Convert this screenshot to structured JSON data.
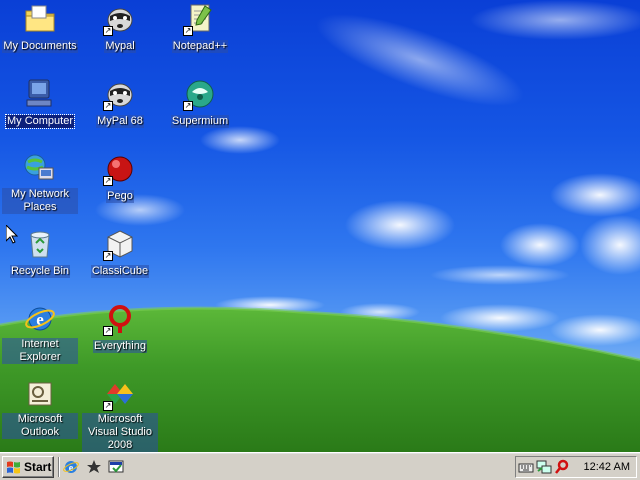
{
  "desktop": {
    "icons": [
      {
        "label": "My Documents"
      },
      {
        "label": "Mypal"
      },
      {
        "label": "Notepad++"
      },
      {
        "label": "My Computer"
      },
      {
        "label": "MyPal 68"
      },
      {
        "label": "Supermium"
      },
      {
        "label": "My Network Places"
      },
      {
        "label": "Pego"
      },
      {
        "label": "Recycle Bin"
      },
      {
        "label": "ClassiCube"
      },
      {
        "label": "Internet Explorer"
      },
      {
        "label": "Everything"
      },
      {
        "label": "Microsoft Outlook"
      },
      {
        "label": "Microsoft Visual Studio 2008"
      }
    ],
    "selected": "My Computer"
  },
  "taskbar": {
    "start_label": "Start",
    "quick_launch": [
      "internet-explorer-icon",
      "media-player-icon",
      "desktop-icon"
    ],
    "tray_icons": [
      "keyboard-icon",
      "network-icon",
      "search-icon"
    ],
    "clock": "12:42 AM"
  },
  "colors": {
    "taskbar": "#d4d0c8",
    "sky": "#1556e4",
    "hill": "#3f9a28",
    "selection": "#0b1f7a"
  }
}
